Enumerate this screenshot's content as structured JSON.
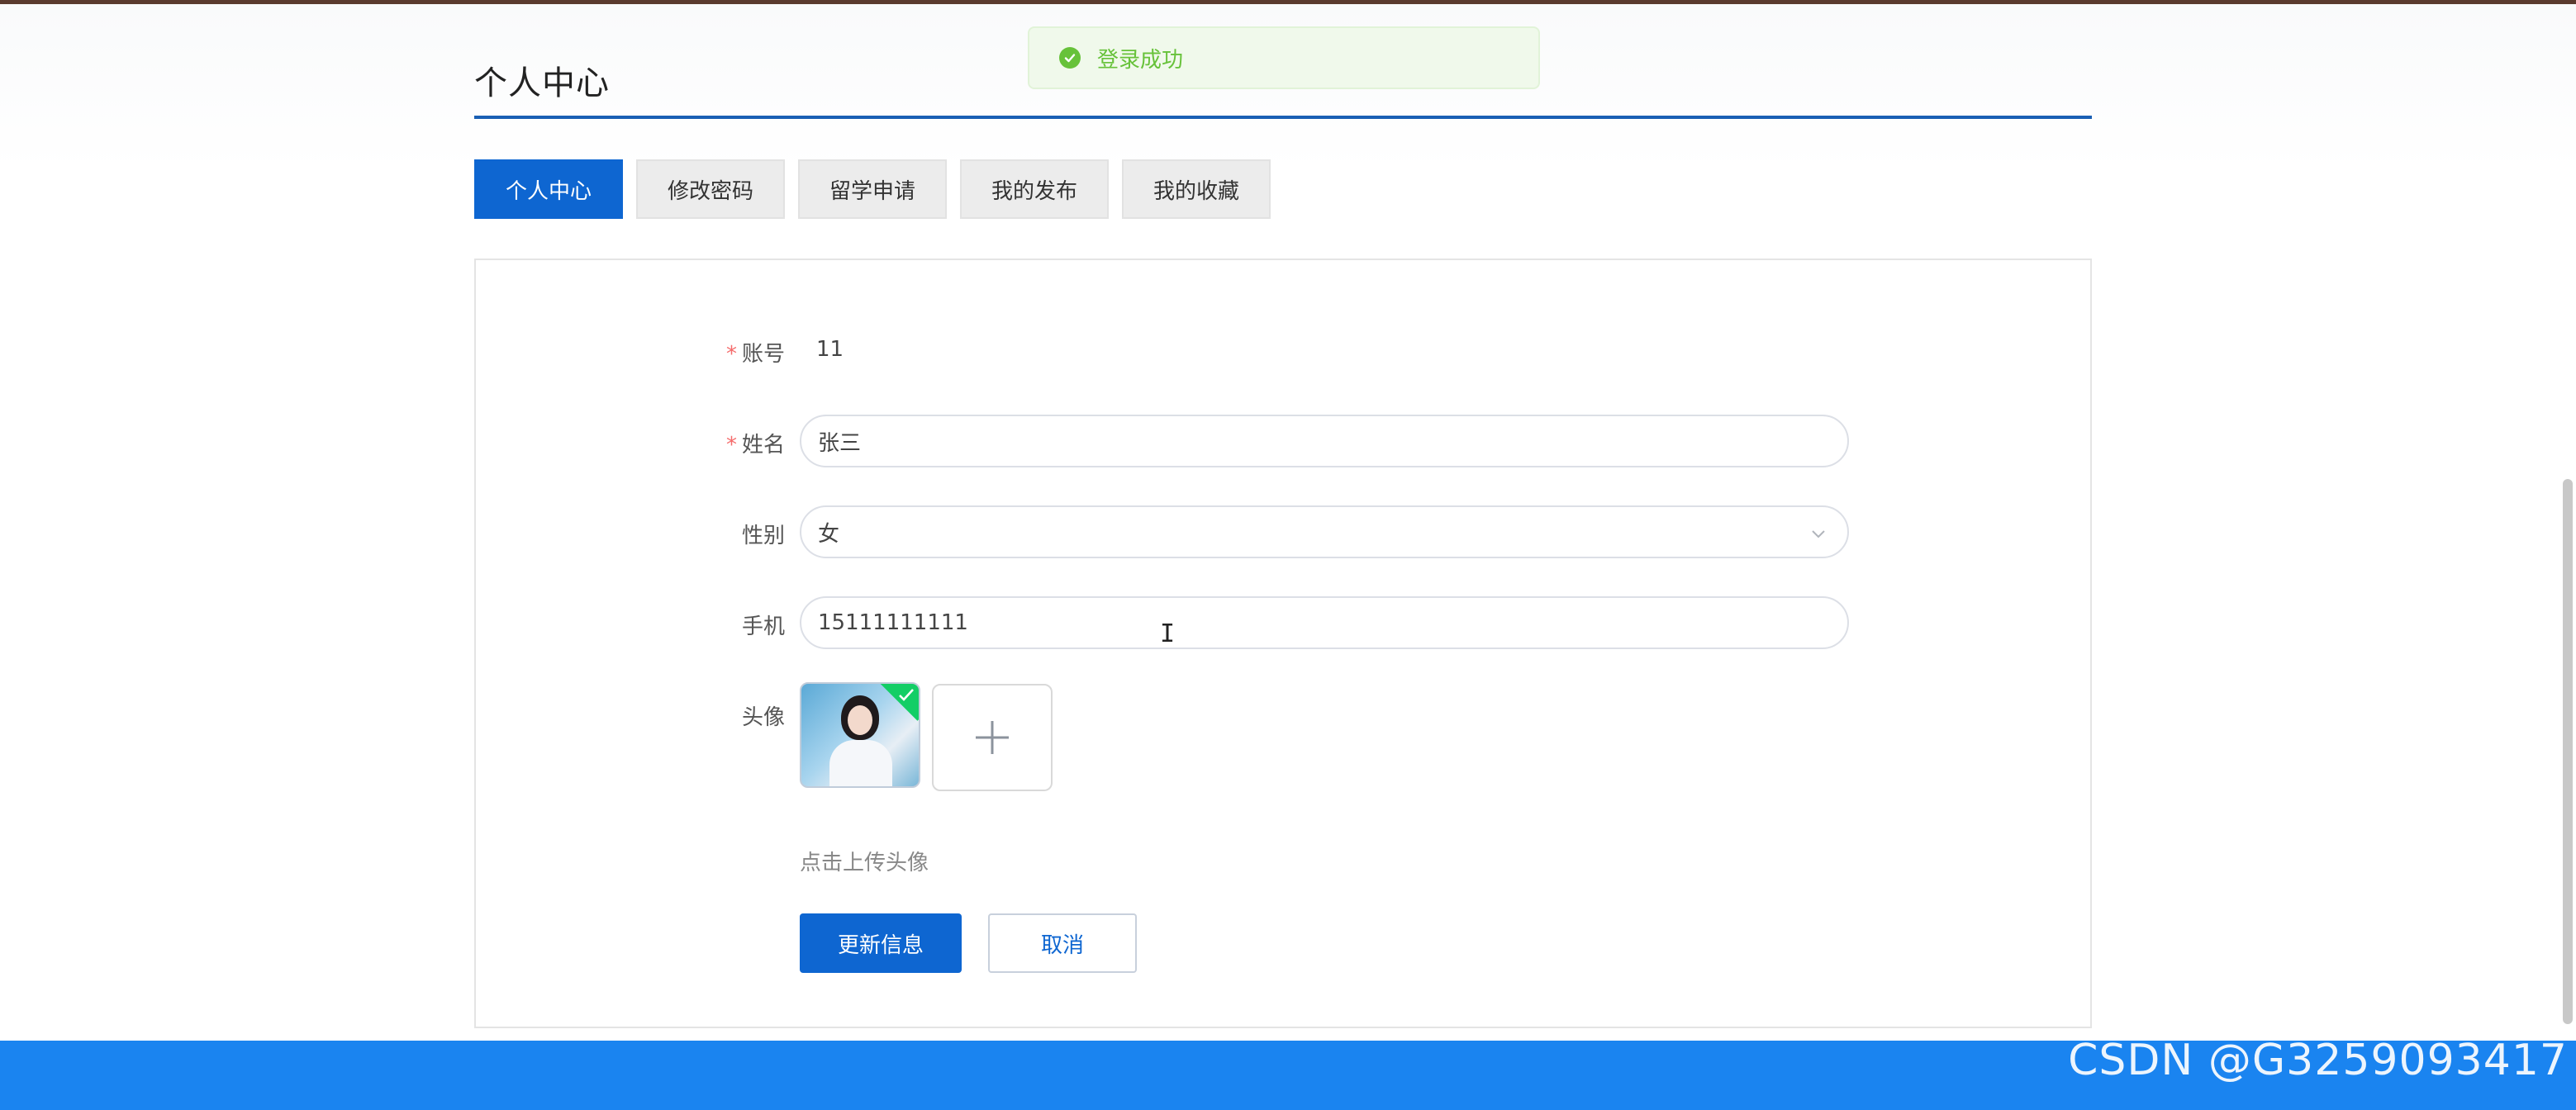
{
  "toast": {
    "message": "登录成功",
    "status_color": "#67c23a"
  },
  "page": {
    "title": "个人中心"
  },
  "tabs": [
    {
      "label": "个人中心",
      "active": true
    },
    {
      "label": "修改密码",
      "active": false
    },
    {
      "label": "留学申请",
      "active": false
    },
    {
      "label": "我的发布",
      "active": false
    },
    {
      "label": "我的收藏",
      "active": false
    }
  ],
  "form": {
    "account": {
      "label": "账号",
      "required": "*",
      "value": "11"
    },
    "name": {
      "label": "姓名",
      "required": "*",
      "value": "张三"
    },
    "gender": {
      "label": "性别",
      "value": "女"
    },
    "phone": {
      "label": "手机",
      "value": "15111111111"
    },
    "avatar": {
      "label": "头像",
      "hint": "点击上传头像"
    }
  },
  "buttons": {
    "submit": "更新信息",
    "cancel": "取消"
  },
  "watermark": "CSDN @G3259093417",
  "colors": {
    "primary": "#0e66d1",
    "footer": "#1a84f0",
    "required": "#f56c6c"
  }
}
